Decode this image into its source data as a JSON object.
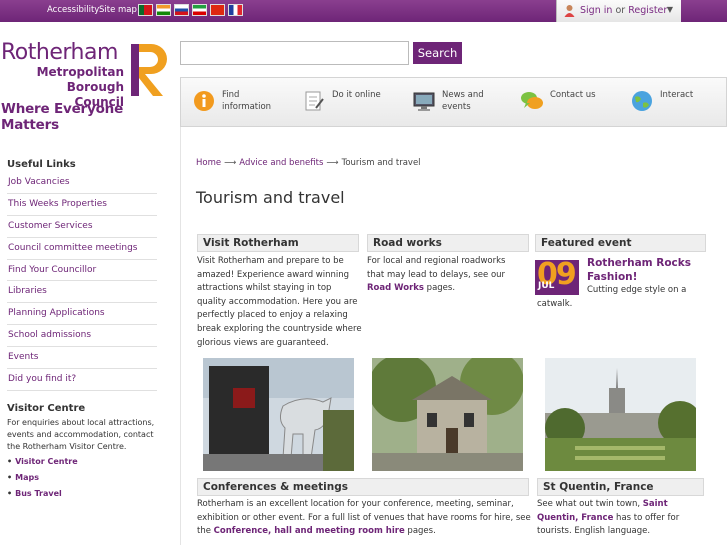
{
  "topbar": {
    "accessibility": "Accessibility",
    "sitemap": "Site map",
    "flags": [
      "Portuguese flag",
      "Indian flag",
      "Slovak flag",
      "Iranian flag",
      "Chinese flag",
      "French flag"
    ],
    "sign_in": "Sign in",
    "or": "or",
    "register": "Register"
  },
  "logo": {
    "line1": "Rotherham",
    "line2a": "Metropolitan",
    "line2b": "Borough Council",
    "tagline": "Where Everyone Matters"
  },
  "search": {
    "placeholder": "",
    "button": "Search"
  },
  "quicknav": [
    {
      "label": "Find information",
      "icon": "info-icon"
    },
    {
      "label": "Do it online",
      "icon": "form-icon"
    },
    {
      "label": "News and events",
      "icon": "monitor-icon"
    },
    {
      "label": "Contact us",
      "icon": "chat-icon"
    },
    {
      "label": "Interact",
      "icon": "globe-icon"
    }
  ],
  "sidebar": {
    "useful_links_title": "Useful Links",
    "links": [
      "Job Vacancies",
      "This Weeks Properties",
      "Customer Services",
      "Council committee meetings",
      "Find Your Councillor",
      "Libraries",
      "Planning Applications",
      "School admissions",
      "Events",
      "Did you find it?"
    ],
    "visitor_centre_title": "Visitor Centre",
    "visitor_centre_text": "For enquiries about local attractions, events and accommodation, contact the Rotherham Visitor Centre.",
    "visitor_links": [
      "Visitor Centre",
      "Maps",
      "Bus Travel"
    ]
  },
  "breadcrumb": {
    "home": "Home",
    "advice": "Advice and benefits",
    "current": "Tourism and travel"
  },
  "page_title": "Tourism and travel",
  "boxes": {
    "visit": {
      "title": "Visit Rotherham",
      "text": "Visit Rotherham and prepare to be amazed! Experience award winning attractions whilst staying in top quality accommodation. Here you are perfectly placed to enjoy a relaxing break exploring the countryside where glorious views are guaranteed."
    },
    "roadworks": {
      "title": "Road works",
      "text_before": "For local and regional roadworks that may lead to delays, see our ",
      "link": "Road Works",
      "text_after": " pages."
    },
    "featured": {
      "title": "Featured event",
      "day": "09",
      "month": "JUL",
      "event_title": "Rotherham Rocks Fashion!",
      "event_desc": "Cutting edge style on a catwalk."
    },
    "conferences": {
      "title": "Conferences & meetings",
      "text_before": "Rotherham is an excellent location for your conference, meeting, seminar, exhibition or other event. For a full list of venues that have rooms for hire, see the ",
      "link": "Conference, hall and meeting room hire",
      "text_after": " pages."
    },
    "stquentin": {
      "title": "St Quentin, France",
      "text_before": "See what out twin town, ",
      "link": "Saint Quentin, France",
      "text_after": " has to offer for tourists. English language."
    }
  },
  "colors": {
    "brand": "#6e2577",
    "accent": "#f0a020"
  }
}
